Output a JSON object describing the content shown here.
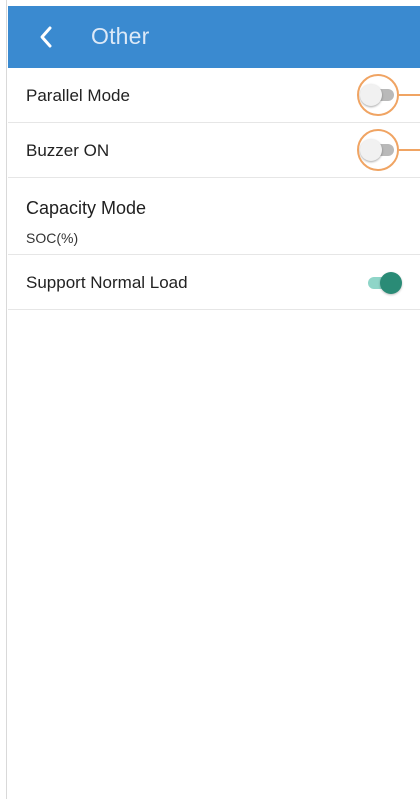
{
  "header": {
    "title": "Other",
    "background_color": "#3a8ad0",
    "back_icon": "chevron-left-icon"
  },
  "settings": {
    "parallel_mode": {
      "label": "Parallel Mode",
      "enabled": false
    },
    "buzzer_on": {
      "label": "Buzzer ON",
      "enabled": false
    },
    "capacity_mode": {
      "label": "Capacity Mode",
      "value": "SOC(%)"
    },
    "support_normal_load": {
      "label": "Support Normal Load",
      "enabled": true
    }
  },
  "colors": {
    "toggle_on_thumb": "#2a8b76",
    "toggle_on_track": "#8fd5c8",
    "toggle_off_track": "#b9b9b9",
    "callout": "#f0a463"
  }
}
